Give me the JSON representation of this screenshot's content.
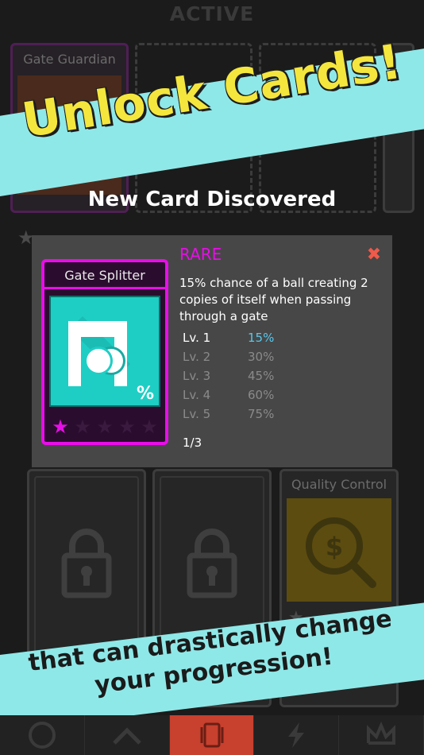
{
  "header": {
    "title": "ACTIVE"
  },
  "background_cards": {
    "guardian_title": "Gate Guardian",
    "quality_control_title": "Quality Control"
  },
  "promo": {
    "headline": "Unlock Cards!",
    "subline": "that can drastically change your progression!"
  },
  "discovered_title": "New Card Discovered",
  "modal": {
    "card_name": "Gate Splitter",
    "rarity": "RARE",
    "description": "15% chance of a ball creating 2 copies of itself when passing through a gate",
    "card_badge": "%",
    "levels": [
      {
        "label": "Lv. 1",
        "value": "15%",
        "current": true
      },
      {
        "label": "Lv. 2",
        "value": "30%",
        "current": false
      },
      {
        "label": "Lv. 3",
        "value": "45%",
        "current": false
      },
      {
        "label": "Lv. 4",
        "value": "60%",
        "current": false
      },
      {
        "label": "Lv. 5",
        "value": "75%",
        "current": false
      }
    ],
    "progress": "1/3",
    "stars_filled": 1,
    "stars_total": 5
  },
  "nav": {
    "tabs": [
      "circle-icon",
      "chevron-up-icon",
      "card-icon",
      "lightning-icon",
      "crown-icon"
    ],
    "active_index": 2
  },
  "colors": {
    "accent_magenta": "#e80ee8",
    "teal": "#1ecec4",
    "banner": "#8fe8e8",
    "headline_yellow": "#f4e63d",
    "close_red": "#f05a4a",
    "level_current": "#5cc6e8",
    "level_other": "#8a8a8a"
  }
}
